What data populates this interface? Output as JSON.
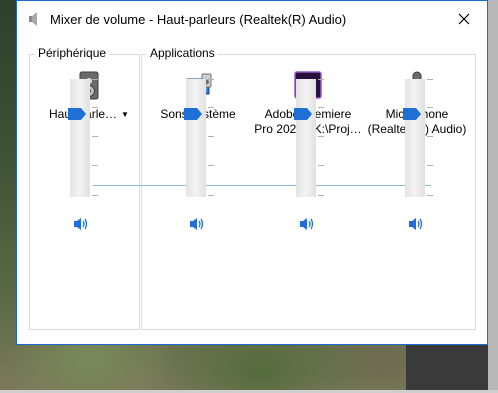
{
  "window": {
    "title": "Mixer de volume - Haut-parleurs (Realtek(R) Audio)",
    "accent": "#1d6ad1"
  },
  "groups": {
    "device_label": "Périphérique",
    "apps_label": "Applications"
  },
  "channels": [
    {
      "name": "Haut-parleurs",
      "display": "Haut-parle…",
      "icon": "speaker-device-icon",
      "has_dropdown": true,
      "volume": 0.7
    },
    {
      "name": "Sons système",
      "display": "Sons système",
      "icon": "system-sounds-icon",
      "volume": 0.7
    },
    {
      "name": "Adobe Premiere Pro 2020 - K:\\Proj…",
      "display_line1": "Adobe Premiere",
      "display_line2": "Pro 2020 - K:\\Proj…",
      "icon": "premiere-pro-icon",
      "volume": 0.7
    },
    {
      "name": "Microphone (Realtek(R) Audio)",
      "display_line1": "Microphone",
      "display_line2": "(Realtek(R) Audio)",
      "icon": "microphone-icon",
      "volume": 0.7
    }
  ],
  "colors": {
    "thumb": "#1f70d6",
    "link_line": "#8fb6e3",
    "speaker": "#1f70d6"
  }
}
